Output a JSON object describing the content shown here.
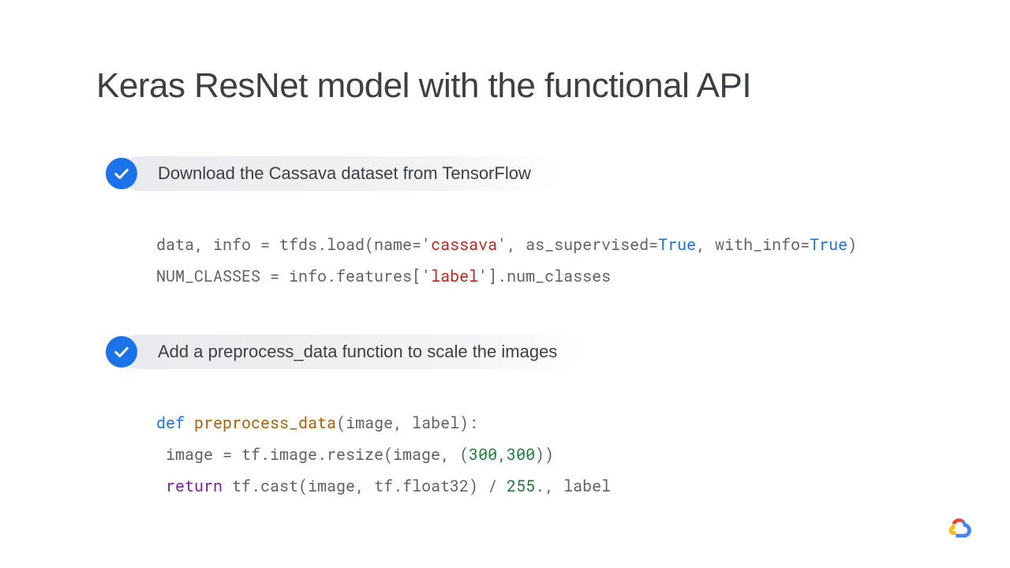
{
  "title": "Keras ResNet model with the functional API",
  "sections": [
    {
      "label": "Download the Cassava dataset from TensorFlow",
      "code": {
        "l1a": "data, info = tfds.load(name=",
        "l1b": "'cassava'",
        "l1c": ", as_supervised=",
        "l1d": "True",
        "l1e": ", with_info=",
        "l1f": "True",
        "l1g": ")",
        "l2a": "NUM_CLASSES = info.features[",
        "l2b": "'label'",
        "l2c": "].num_classes"
      }
    },
    {
      "label": "Add a preprocess_data function to scale the images",
      "code": {
        "l1a": "def",
        "l1b": " ",
        "l1c": "preprocess_data",
        "l1d": "(image, label):",
        "l2a": " image = tf.image.resize(image, (",
        "l2b": "300",
        "l2c": ",",
        "l2d": "300",
        "l2e": "))",
        "l3a": " ",
        "l3b": "return",
        "l3c": " tf.cast(image, tf.float32) / ",
        "l3d": "255",
        "l3e": "., label"
      }
    }
  ]
}
